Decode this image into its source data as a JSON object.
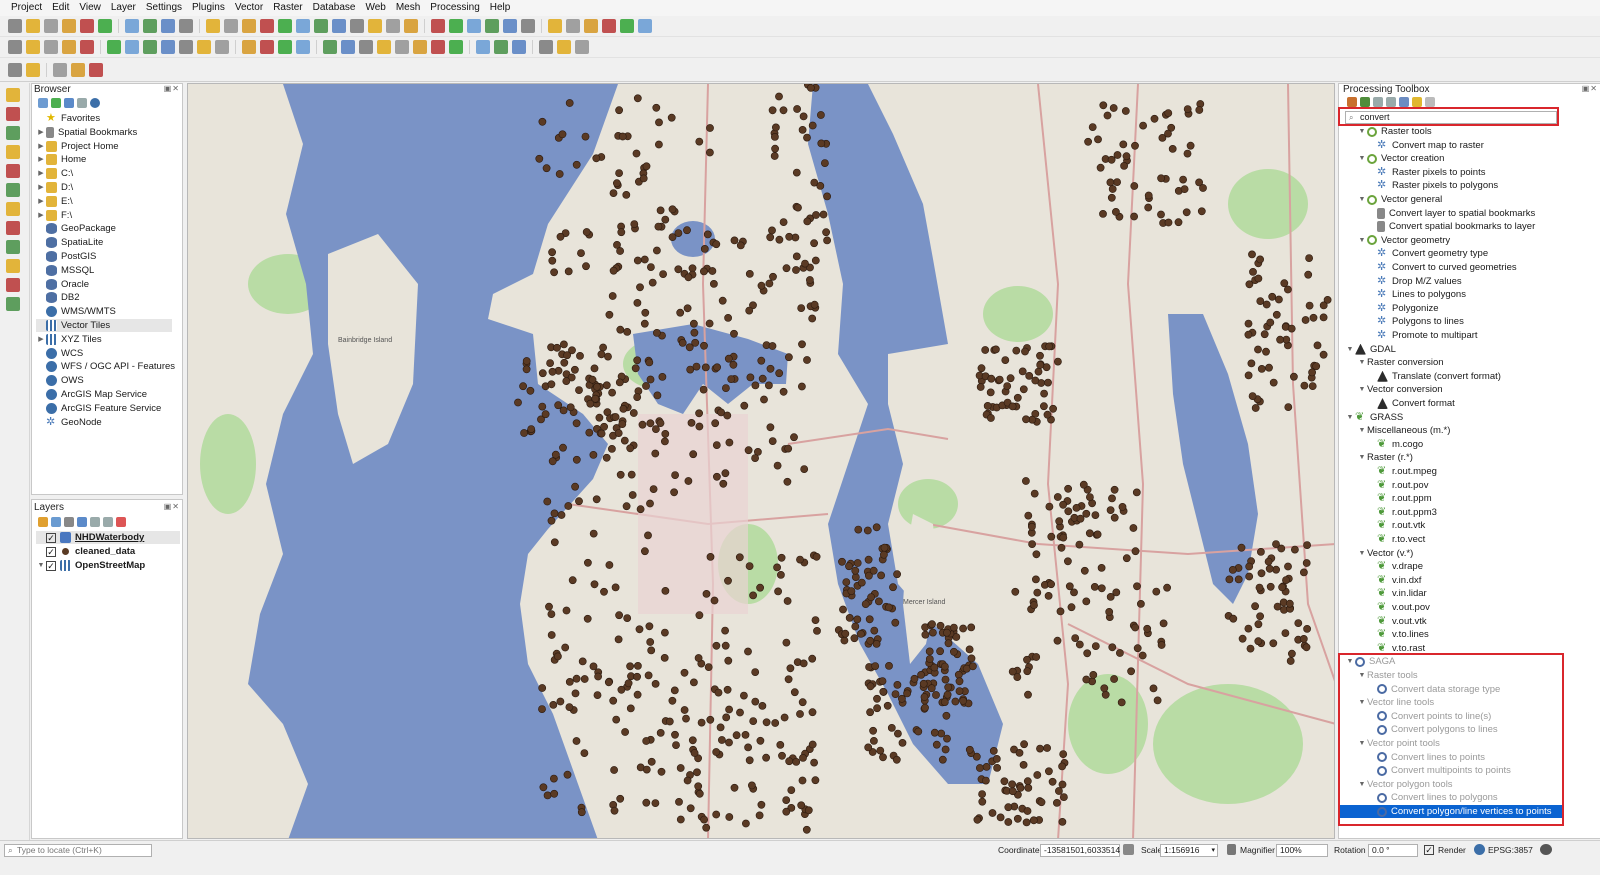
{
  "menu": [
    "Project",
    "Edit",
    "View",
    "Layer",
    "Settings",
    "Plugins",
    "Vector",
    "Raster",
    "Database",
    "Web",
    "Mesh",
    "Processing",
    "Help"
  ],
  "browser": {
    "title": "Browser",
    "items": [
      {
        "label": "Favorites",
        "icon": "star"
      },
      {
        "label": "Spatial Bookmarks",
        "icon": "bm"
      },
      {
        "label": "Project Home",
        "icon": "folder"
      },
      {
        "label": "Home",
        "icon": "folder"
      },
      {
        "label": "C:\\",
        "icon": "folder"
      },
      {
        "label": "D:\\",
        "icon": "folder"
      },
      {
        "label": "E:\\",
        "icon": "folder"
      },
      {
        "label": "F:\\",
        "icon": "folder"
      },
      {
        "label": "GeoPackage",
        "icon": "db"
      },
      {
        "label": "SpatiaLite",
        "icon": "db"
      },
      {
        "label": "PostGIS",
        "icon": "db"
      },
      {
        "label": "MSSQL",
        "icon": "db"
      },
      {
        "label": "Oracle",
        "icon": "db"
      },
      {
        "label": "DB2",
        "icon": "db"
      },
      {
        "label": "WMS/WMTS",
        "icon": "globe"
      },
      {
        "label": "Vector Tiles",
        "icon": "grid"
      },
      {
        "label": "XYZ Tiles",
        "icon": "grid"
      },
      {
        "label": "WCS",
        "icon": "globe"
      },
      {
        "label": "WFS / OGC API - Features",
        "icon": "globe"
      },
      {
        "label": "OWS",
        "icon": "globe"
      },
      {
        "label": "ArcGIS Map Service",
        "icon": "globe"
      },
      {
        "label": "ArcGIS Feature Service",
        "icon": "globe"
      },
      {
        "label": "GeoNode",
        "icon": "gear"
      }
    ]
  },
  "layers": {
    "title": "Layers",
    "items": [
      {
        "label": "NHDWaterbody"
      },
      {
        "label": "cleaned_data"
      },
      {
        "label": "OpenStreetMap"
      }
    ]
  },
  "toolbox": {
    "title": "Processing Toolbox",
    "search_value": "convert",
    "rows": [
      {
        "label": "Raster tools",
        "level": 1,
        "icon": "q",
        "arrow": true
      },
      {
        "label": "Convert map to raster",
        "level": 2,
        "icon": "gear"
      },
      {
        "label": "Vector creation",
        "level": 1,
        "icon": "q",
        "arrow": true
      },
      {
        "label": "Raster pixels to points",
        "level": 2,
        "icon": "gear"
      },
      {
        "label": "Raster pixels to polygons",
        "level": 2,
        "icon": "gear"
      },
      {
        "label": "Vector general",
        "level": 1,
        "icon": "q",
        "arrow": true
      },
      {
        "label": "Convert layer to spatial bookmarks",
        "level": 2,
        "icon": "bm"
      },
      {
        "label": "Convert spatial bookmarks to layer",
        "level": 2,
        "icon": "bm"
      },
      {
        "label": "Vector geometry",
        "level": 1,
        "icon": "q",
        "arrow": true
      },
      {
        "label": "Convert geometry type",
        "level": 2,
        "icon": "gear"
      },
      {
        "label": "Convert to curved geometries",
        "level": 2,
        "icon": "gear"
      },
      {
        "label": "Drop M/Z values",
        "level": 2,
        "icon": "gear"
      },
      {
        "label": "Lines to polygons",
        "level": 2,
        "icon": "gear"
      },
      {
        "label": "Polygonize",
        "level": 2,
        "icon": "gear"
      },
      {
        "label": "Polygons to lines",
        "level": 2,
        "icon": "gear"
      },
      {
        "label": "Promote to multipart",
        "level": 2,
        "icon": "gear"
      },
      {
        "label": "GDAL",
        "level": 0,
        "icon": "gdal",
        "arrow": true
      },
      {
        "label": "Raster conversion",
        "level": 1,
        "arrow": true
      },
      {
        "label": "Translate (convert format)",
        "level": 2,
        "icon": "gdal"
      },
      {
        "label": "Vector conversion",
        "level": 1,
        "arrow": true
      },
      {
        "label": "Convert format",
        "level": 2,
        "icon": "gdal"
      },
      {
        "label": "GRASS",
        "level": 0,
        "icon": "grass",
        "arrow": true
      },
      {
        "label": "Miscellaneous (m.*)",
        "level": 1,
        "arrow": true
      },
      {
        "label": "m.cogo",
        "level": 2,
        "icon": "grass"
      },
      {
        "label": "Raster (r.*)",
        "level": 1,
        "arrow": true
      },
      {
        "label": "r.out.mpeg",
        "level": 2,
        "icon": "grass"
      },
      {
        "label": "r.out.pov",
        "level": 2,
        "icon": "grass"
      },
      {
        "label": "r.out.ppm",
        "level": 2,
        "icon": "grass"
      },
      {
        "label": "r.out.ppm3",
        "level": 2,
        "icon": "grass"
      },
      {
        "label": "r.out.vtk",
        "level": 2,
        "icon": "grass"
      },
      {
        "label": "r.to.vect",
        "level": 2,
        "icon": "grass"
      },
      {
        "label": "Vector (v.*)",
        "level": 1,
        "arrow": true
      },
      {
        "label": "v.drape",
        "level": 2,
        "icon": "grass"
      },
      {
        "label": "v.in.dxf",
        "level": 2,
        "icon": "grass"
      },
      {
        "label": "v.in.lidar",
        "level": 2,
        "icon": "grass"
      },
      {
        "label": "v.out.pov",
        "level": 2,
        "icon": "grass"
      },
      {
        "label": "v.out.vtk",
        "level": 2,
        "icon": "grass"
      },
      {
        "label": "v.to.lines",
        "level": 2,
        "icon": "grass"
      },
      {
        "label": "v.to.rast",
        "level": 2,
        "icon": "grass"
      },
      {
        "label": "SAGA",
        "level": 0,
        "icon": "saga",
        "arrow": true,
        "dim": true
      },
      {
        "label": "Raster tools",
        "level": 1,
        "arrow": true,
        "dim": true
      },
      {
        "label": "Convert data storage type",
        "level": 2,
        "icon": "saga",
        "dim": true
      },
      {
        "label": "Vector line tools",
        "level": 1,
        "arrow": true,
        "dim": true
      },
      {
        "label": "Convert points to line(s)",
        "level": 2,
        "icon": "saga",
        "dim": true
      },
      {
        "label": "Convert polygons to lines",
        "level": 2,
        "icon": "saga",
        "dim": true
      },
      {
        "label": "Vector point tools",
        "level": 1,
        "arrow": true,
        "dim": true
      },
      {
        "label": "Convert lines to points",
        "level": 2,
        "icon": "saga",
        "dim": true
      },
      {
        "label": "Convert multipoints to points",
        "level": 2,
        "icon": "saga",
        "dim": true
      },
      {
        "label": "Vector polygon tools",
        "level": 1,
        "arrow": true,
        "dim": true
      },
      {
        "label": "Convert lines to polygons",
        "level": 2,
        "icon": "saga",
        "dim": true
      },
      {
        "label": "Convert polygon/line vertices to points",
        "level": 2,
        "icon": "saga",
        "selected": true
      }
    ]
  },
  "status": {
    "locator_placeholder": "Type to locate (Ctrl+K)",
    "coordinate_label": "Coordinate",
    "coordinate_value": "-13581501,6033514",
    "scale_label": "Scale",
    "scale_value": "1:156916",
    "magnifier_label": "Magnifier",
    "magnifier_value": "100%",
    "rotation_label": "Rotation",
    "rotation_value": "0.0 °",
    "render_label": "Render",
    "crs": "EPSG:3857"
  },
  "map_labels": [
    "Bainbridge Island",
    "Mercer Island"
  ],
  "colors": {
    "water": "#7a93c6",
    "land": "#e8e4da",
    "park": "#b9dca5",
    "points": "#5a3a24",
    "highlight": "#d9262c",
    "selection": "#0a63d1"
  }
}
